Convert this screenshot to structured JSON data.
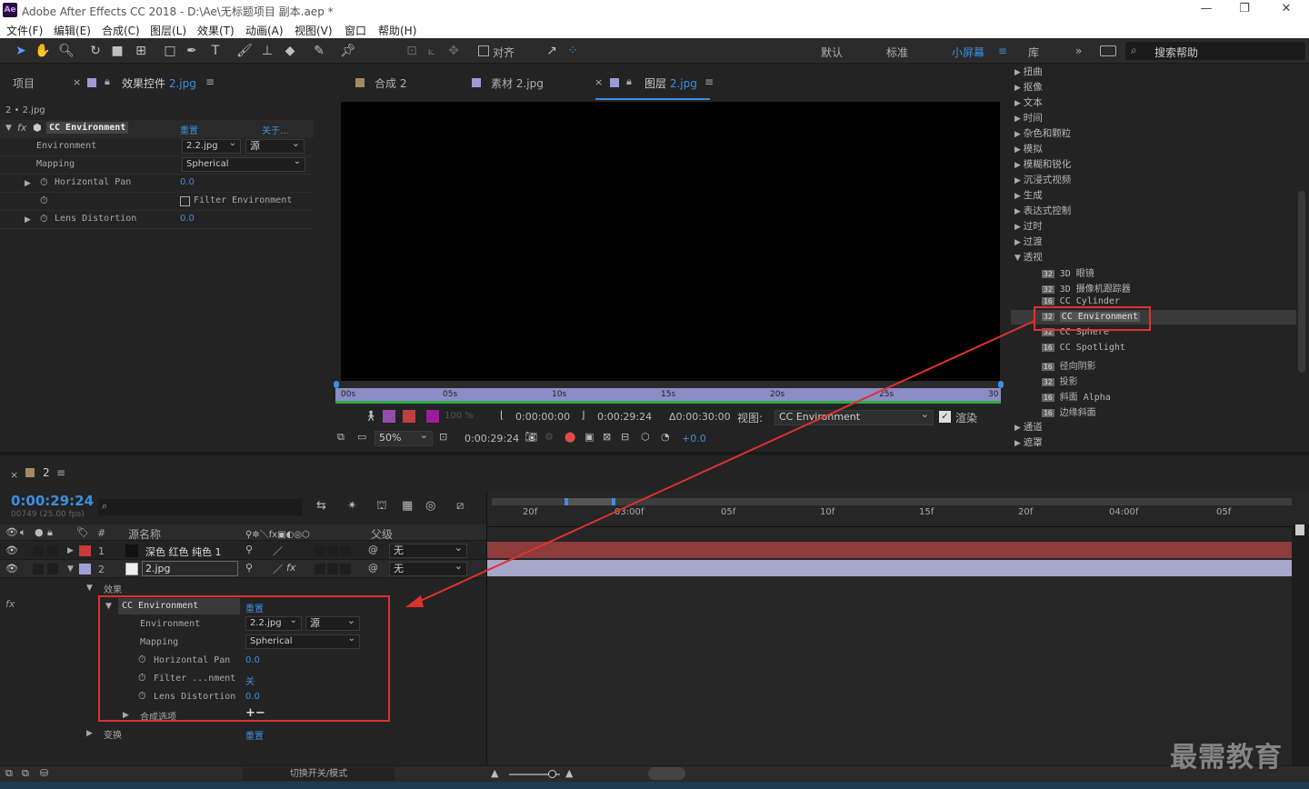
{
  "app": {
    "title": "Adobe After Effects CC 2018 - D:\\Ae\\无标题项目 副本.aep *",
    "logo": "Ae",
    "min": "—",
    "max": "❐",
    "close": "✕"
  },
  "menu": [
    "文件(F)",
    "编辑(E)",
    "合成(C)",
    "图层(L)",
    "效果(T)",
    "动画(A)",
    "视图(V)",
    "窗口",
    "帮助(H)"
  ],
  "toolbar": {
    "align_label": "对齐",
    "workspaces": [
      "默认",
      "标准",
      "小屏幕",
      "库"
    ],
    "active_ws": "小屏幕",
    "search_placeholder": "搜索帮助",
    "more": "»"
  },
  "left_panel": {
    "tab_project": "项目",
    "tab_effects_prefix": "效果控件",
    "tab_effects_file": "2.jpg",
    "layer_path": "2 • 2.jpg",
    "effect": {
      "name": "CC Environment",
      "reset": "重置",
      "about": "关于...",
      "props": [
        {
          "label": "Environment",
          "value": "2.2.jpg",
          "value2": "源"
        },
        {
          "label": "Mapping",
          "value": "Spherical"
        },
        {
          "label": "Horizontal Pan",
          "value": "0.0"
        },
        {
          "label": "Filter Environment"
        },
        {
          "label": "Lens Distortion",
          "value": "0.0"
        }
      ]
    }
  },
  "viewer": {
    "tabs": [
      {
        "label": "合成 2",
        "color": "#a48a5e"
      },
      {
        "label": "素材 2.jpg",
        "color": "#9c9cd4"
      },
      {
        "label": "图层",
        "file": "2.jpg",
        "color": "#9c9cd4"
      }
    ],
    "ruler": [
      "00s",
      "05s",
      "10s",
      "15s",
      "20s",
      "25s",
      "30"
    ],
    "tc_in": "0:00:00:00",
    "tc_out": "0:00:29:24",
    "tc_dur": "Δ0:00:30:00",
    "view_label": "视图:",
    "view_value": "CC Environment",
    "render_label": "渲染",
    "zoom": "50%",
    "tc_current": "0:00:29:24",
    "exposure": "+0.0",
    "opacity": "100 %"
  },
  "effects_list": {
    "categories_top": [
      "扭曲",
      "抠像",
      "文本",
      "时间",
      "杂色和颗粒",
      "模拟",
      "模糊和锐化",
      "沉浸式视频",
      "生成",
      "表达式控制",
      "过时",
      "过渡"
    ],
    "open_category": "透视",
    "items": [
      {
        "badge": "32",
        "label": "3D 眼镜"
      },
      {
        "badge": "32",
        "label": "3D 摄像机跟踪器"
      },
      {
        "badge": "16",
        "label": "CC Cylinder"
      },
      {
        "badge": "32",
        "label": "CC Environment"
      },
      {
        "badge": "32",
        "label": "CC Sphere"
      },
      {
        "badge": "16",
        "label": "CC Spotlight"
      },
      {
        "badge": "16",
        "label": "径向阴影"
      },
      {
        "badge": "32",
        "label": "投影"
      },
      {
        "badge": "16",
        "label": "斜面 Alpha"
      },
      {
        "badge": "16",
        "label": "边缘斜面"
      }
    ],
    "categories_bottom": [
      "通道",
      "遮罩"
    ]
  },
  "timeline": {
    "tab": "2",
    "timecode": "0:00:29:24",
    "frames": "00749 (25.00 fps)",
    "search_placeholder": "",
    "col_source": "源名称",
    "col_parent": "父级",
    "col_num": "#",
    "layers": [
      {
        "num": "1",
        "name": "深色 红色 纯色 1",
        "parent": "无",
        "color": "#c83a3a"
      },
      {
        "num": "2",
        "name": "2.jpg",
        "parent": "无",
        "color": "#a0a0d8"
      }
    ],
    "effects_group": "效果",
    "effect": {
      "name": "CC Environment",
      "reset": "重置",
      "props": [
        {
          "label": "Environment",
          "value": "2.2.jpg",
          "value2": "源"
        },
        {
          "label": "Mapping",
          "value": "Spherical"
        },
        {
          "label": "Horizontal Pan",
          "value": "0.0"
        },
        {
          "label": "Filter ...nment",
          "value": "关"
        },
        {
          "label": "Lens Distortion",
          "value": "0.0"
        },
        {
          "label": "合成选项",
          "value": "+−"
        }
      ]
    },
    "transform": "变换",
    "transform_reset": "重置",
    "ruler": [
      "20f",
      "03:00f",
      "05f",
      "10f",
      "15f",
      "20f",
      "04:00f",
      "05f"
    ],
    "bottom_toggle": "切换开关/模式"
  },
  "watermark": "最需教育",
  "colors": {
    "accent": "#3b8fe0",
    "highlight": "#e03030",
    "bar1": "#8d3b3b",
    "bar2": "#a7a7c9"
  }
}
